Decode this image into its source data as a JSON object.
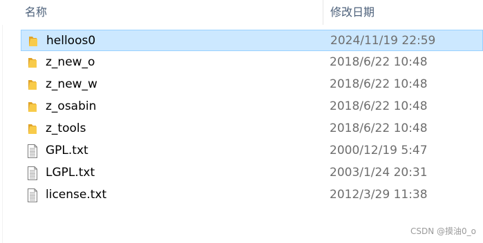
{
  "columns": {
    "name": "名称",
    "date_modified": "修改日期"
  },
  "files": [
    {
      "name": "helloos0",
      "date": "2024/11/19 22:59",
      "type": "folder",
      "selected": true
    },
    {
      "name": "z_new_o",
      "date": "2018/6/22 10:48",
      "type": "folder",
      "selected": false
    },
    {
      "name": "z_new_w",
      "date": "2018/6/22 10:48",
      "type": "folder",
      "selected": false
    },
    {
      "name": "z_osabin",
      "date": "2018/6/22 10:48",
      "type": "folder",
      "selected": false
    },
    {
      "name": "z_tools",
      "date": "2018/6/22 10:48",
      "type": "folder",
      "selected": false
    },
    {
      "name": "GPL.txt",
      "date": "2000/12/19 5:47",
      "type": "text-file",
      "selected": false
    },
    {
      "name": "LGPL.txt",
      "date": "2003/1/24 20:31",
      "type": "text-file",
      "selected": false
    },
    {
      "name": "license.txt",
      "date": "2012/3/29 11:38",
      "type": "text-file",
      "selected": false
    }
  ],
  "watermark": "CSDN @摸油0_o",
  "colors": {
    "selection_bg": "#cce8ff",
    "selection_border": "#99d1ff",
    "folder_yellow": "#f8cb4a",
    "header_text": "#4c607a",
    "date_text": "#6d6d6d"
  },
  "icons": {
    "folder": "folder-icon",
    "text-file": "text-file-icon"
  }
}
